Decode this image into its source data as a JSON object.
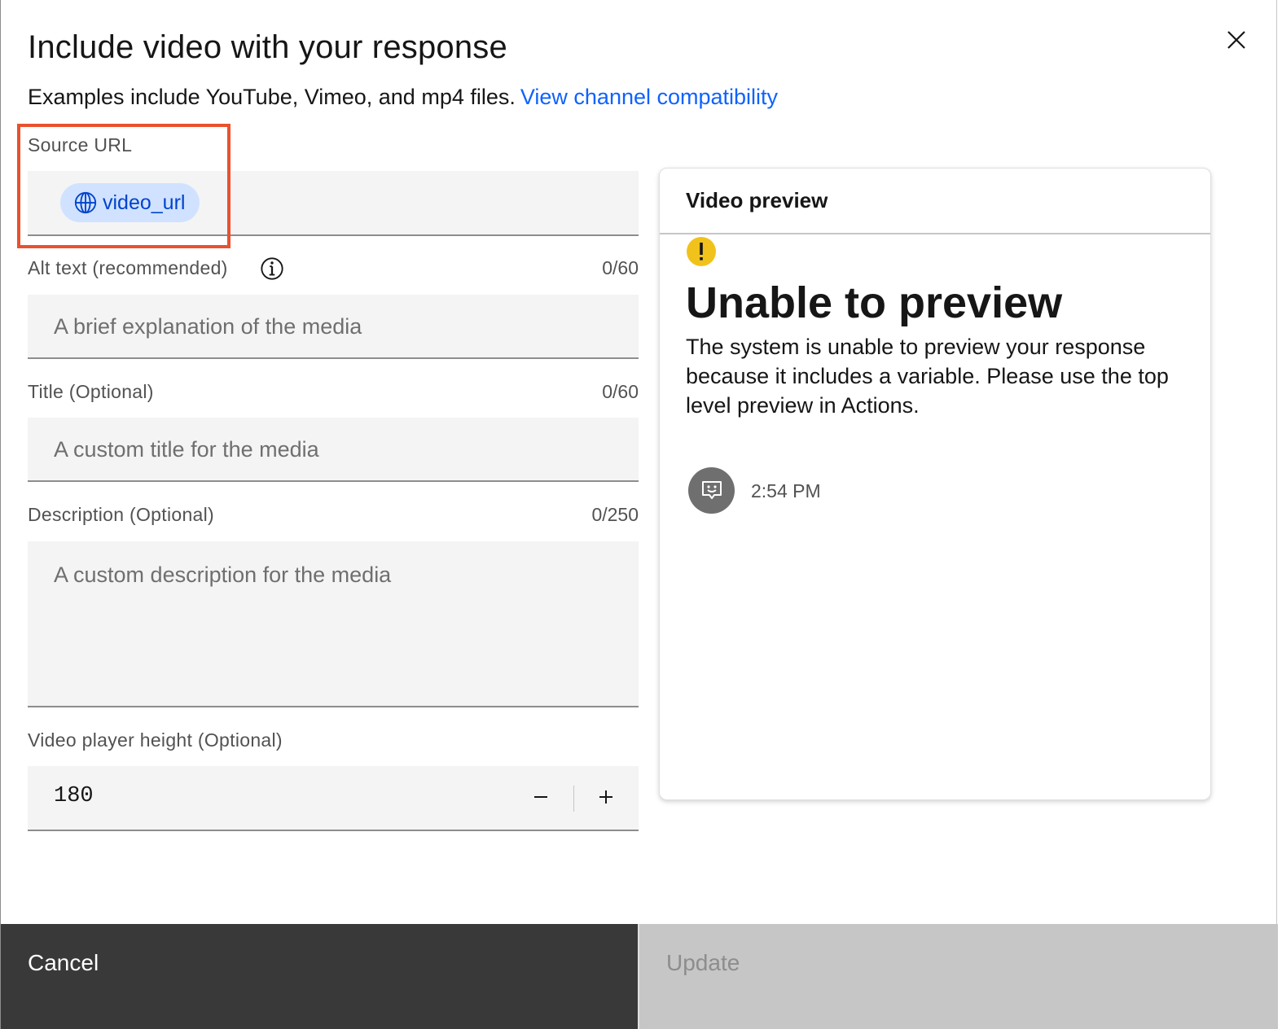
{
  "modal": {
    "title": "Include video with your response",
    "subtitle": "Examples include YouTube, Vimeo, and mp4 files.",
    "subtitle_link": "View channel compatibility",
    "close_icon": "close-icon"
  },
  "form": {
    "source_url": {
      "label": "Source URL",
      "chip_label": "video_url",
      "chip_icon": "globe-icon"
    },
    "alt_text": {
      "label": "Alt text (recommended)",
      "counter": "0/60",
      "placeholder": "A brief explanation of the media",
      "info_icon": "information-icon"
    },
    "title": {
      "label": "Title (Optional)",
      "counter": "0/60",
      "placeholder": "A custom title for the media"
    },
    "description": {
      "label": "Description (Optional)",
      "counter": "0/250",
      "placeholder": "A custom description for the media"
    },
    "player_height": {
      "label": "Video player height (Optional)",
      "value": "180",
      "decrement_icon": "minus-icon",
      "increment_icon": "plus-icon"
    }
  },
  "preview": {
    "header": "Video preview",
    "warning_icon": "warning-icon",
    "heading": "Unable to preview",
    "body": "The system is unable to preview your response because it includes a variable. Please use the top level preview in Actions.",
    "avatar_icon": "bot-avatar-icon",
    "timestamp": "2:54 PM"
  },
  "footer": {
    "cancel_label": "Cancel",
    "update_label": "Update"
  },
  "colors": {
    "link": "#0f62fe",
    "chip_bg": "#d0e2ff",
    "warning": "#f1c21b",
    "highlight": "#e8522f",
    "cancel_bg": "#393939",
    "update_disabled_bg": "#c6c6c6"
  }
}
